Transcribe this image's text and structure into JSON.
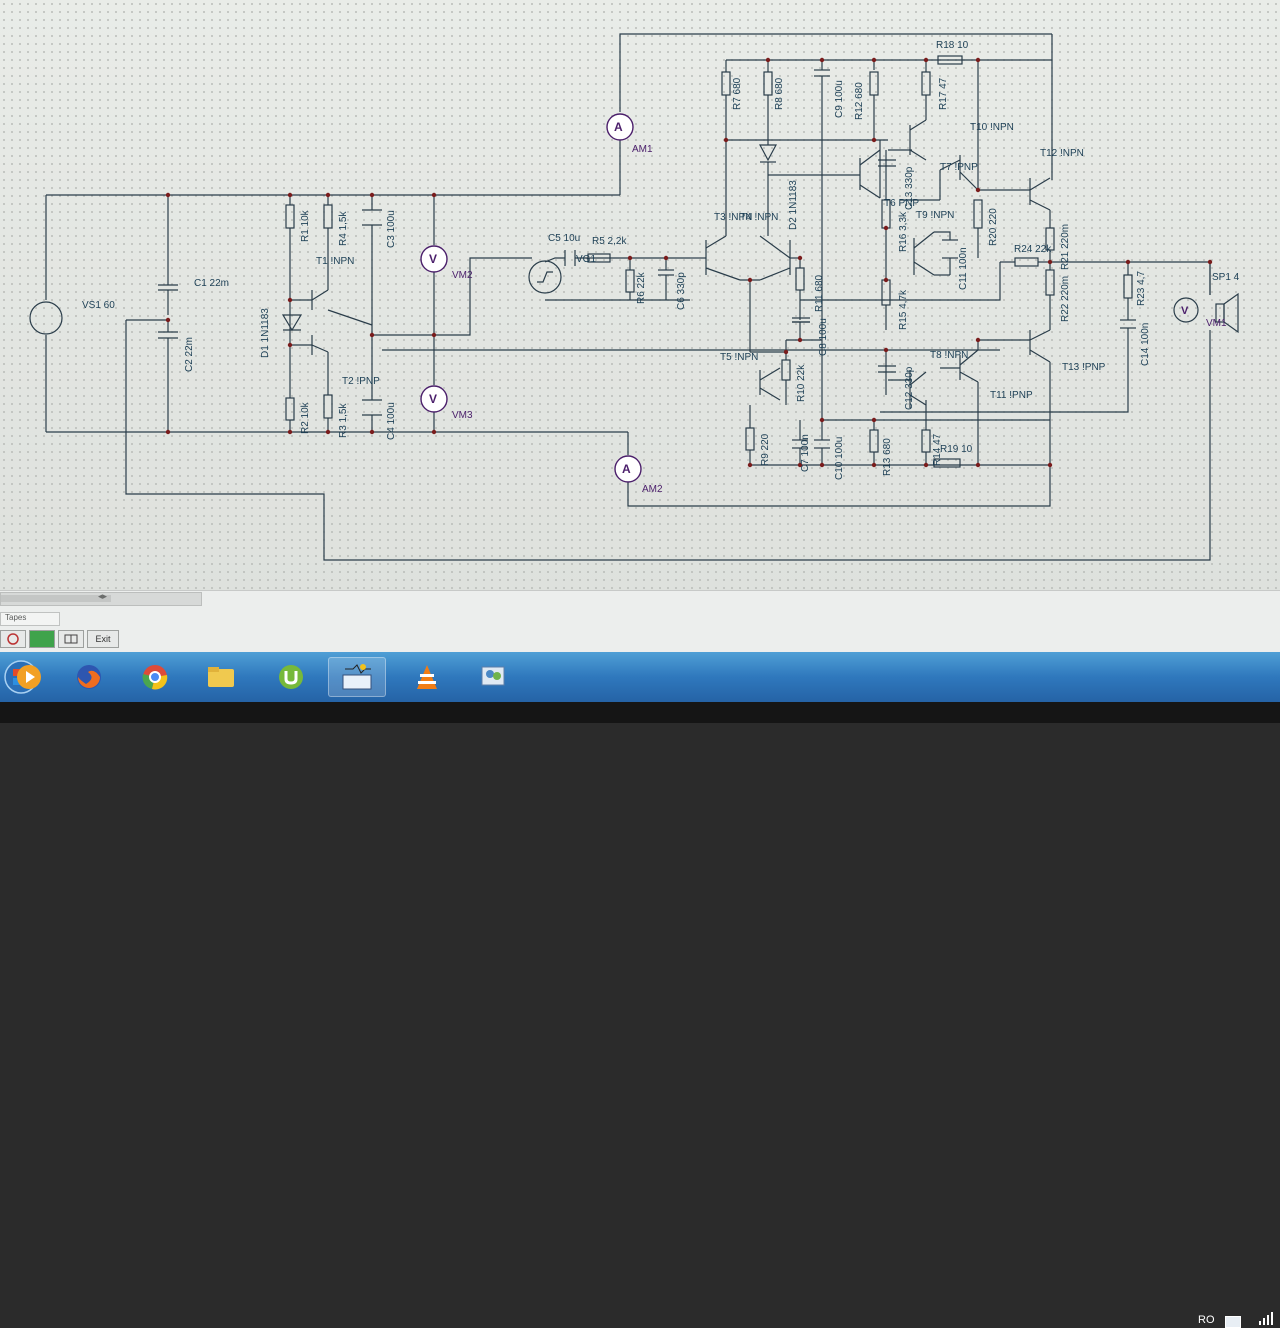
{
  "schematic": {
    "labels": {
      "ammeter_symbol": "A",
      "voltmeter_symbol": "V",
      "am1": "AM1",
      "am2": "AM2",
      "vm2": "VM2",
      "vm3": "VM3",
      "vs1": "VS1 60",
      "c1": "C1 22m",
      "c2": "C2 22m",
      "r1": "R1 10k",
      "r4": "R4 1,5k",
      "c3": "C3 100u",
      "t1": "T1 !NPN",
      "d1": "D1 1N1183",
      "t2": "T2 !PNP",
      "r2": "R2 10k",
      "r3": "R3 1,5k",
      "c4": "C4 100u",
      "c5": "C5 10u",
      "r5": "R5 2,2k",
      "vg1": "VG1",
      "r6": "R6 22k",
      "c6": "C6 330p",
      "r7": "R7 680",
      "r8": "R8 680",
      "c9": "C9 100u",
      "r12": "R12 680",
      "r18": "R18 10",
      "r17": "R17 47",
      "t3": "T3 !NPN",
      "t4": "T4 !NPN",
      "d2": "D2 1N1183",
      "r11": "R11 680",
      "c8": "C8 100u",
      "t5": "T5 !NPN",
      "r10": "R10 22k",
      "r9": "R9 220",
      "c7": "C7 100n",
      "c10": "C10 100u",
      "r13": "R13 680",
      "c13": "C13 330p",
      "t6": "T6 PNP",
      "t7": "T7 !PNP",
      "r16": "R16 3,3k",
      "t9": "T9 !NPN",
      "c11": "C11 100n",
      "r15": "R15 4,7k",
      "c12": "C12 330p",
      "t8": "T8 !NPN",
      "r14": "R14 47",
      "r19": "R19 10",
      "t10": "T10 !NPN",
      "t12": "T12 !NPN",
      "r20": "R20 220",
      "r24": "R24 22k",
      "r21": "R21 220m",
      "r22": "R22 220m",
      "t11": "T11 !PNP",
      "t13": "T13 !PNP",
      "r23": "R23 4,7",
      "c14": "C14 100n",
      "sp1": "SP1 4",
      "vm1": "VM1"
    }
  },
  "statusbar": {
    "mode_tab": "Tapes",
    "exit_label": "Exit",
    "scroll_arrow": "◂▸"
  },
  "taskbar": {
    "items": [
      "start-orb",
      "windows-media-player",
      "firefox",
      "chrome",
      "file-explorer",
      "utorrent",
      "circuit-simulator",
      "vlc",
      "image-viewer"
    ],
    "active_item": "circuit-simulator",
    "tray": {
      "language": "RO"
    }
  },
  "colors": {
    "wire": "#2a3d4a",
    "meter": "#4b1f6b",
    "junction": "#7a1d1d",
    "taskbar": "#2f78bd"
  }
}
